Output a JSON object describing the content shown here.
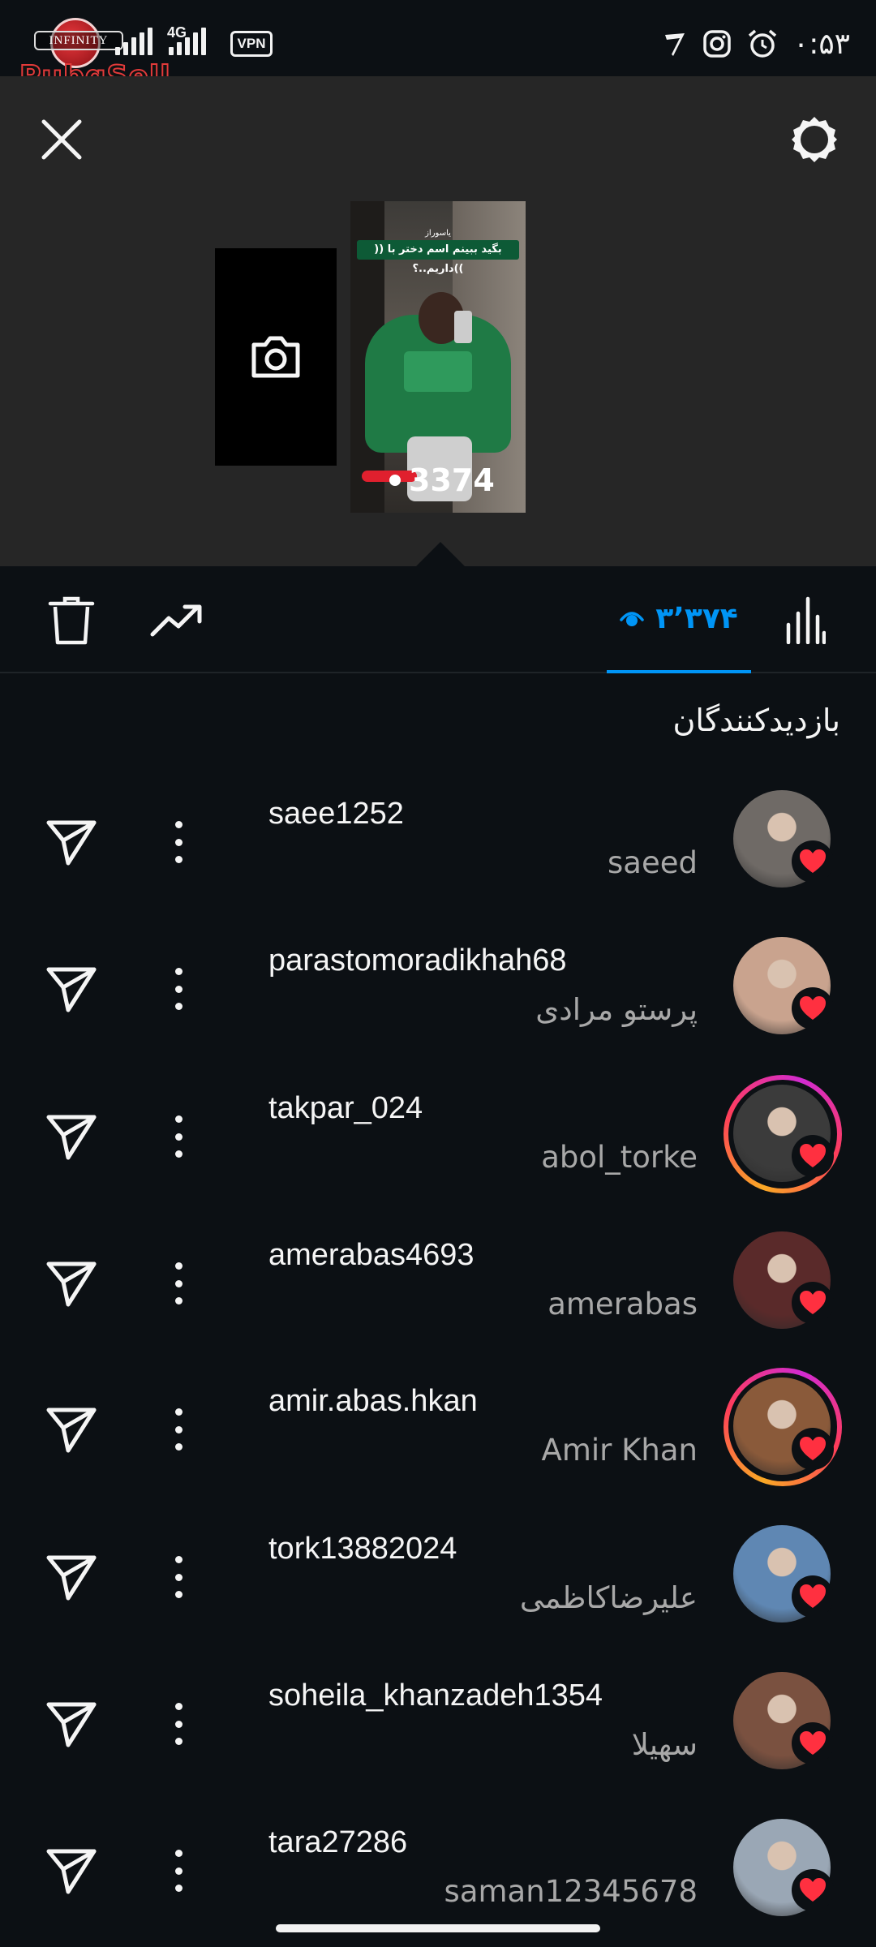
{
  "status_bar": {
    "network_type": "4G",
    "vpn_label": "VPN",
    "time": "۰:۵۳",
    "watermark_brand": "INFINITY",
    "watermark_text": "PubgSell"
  },
  "story": {
    "caption_top": "یاسوراز",
    "caption": "بگید ببینم اسم دختر با (( ))داریم..؟",
    "view_count_overlay": "3374"
  },
  "toolbar": {
    "viewers_count": "۳٬۳۷۴"
  },
  "viewers_section": {
    "title": "بازدیدکنندگان"
  },
  "viewers": [
    {
      "username": "saee1252",
      "full_name": "saeed",
      "has_story_ring": false,
      "avatar_color": "#6f6a66"
    },
    {
      "username": "parastomoradikhah68",
      "full_name": "پرستو مرادی",
      "has_story_ring": false,
      "avatar_color": "#c9a38e"
    },
    {
      "username": "takpar_024",
      "full_name": "abol_torke",
      "has_story_ring": true,
      "avatar_color": "#3b3b3b"
    },
    {
      "username": "amerabas4693",
      "full_name": "amerabas",
      "has_story_ring": false,
      "avatar_color": "#5a2a2a"
    },
    {
      "username": "amir.abas.hkan",
      "full_name": "Amir Khan",
      "has_story_ring": true,
      "avatar_color": "#8a5a3a"
    },
    {
      "username": "tork13882024",
      "full_name": "علیرضاکاظمی",
      "has_story_ring": false,
      "avatar_color": "#5f87b3"
    },
    {
      "username": "soheila_khanzadeh1354",
      "full_name": "سهیلا",
      "has_story_ring": false,
      "avatar_color": "#7a5140"
    },
    {
      "username": "tara27286",
      "full_name": "saman12345678",
      "has_story_ring": false,
      "avatar_color": "#9aa7b5"
    }
  ],
  "colors": {
    "background": "#0c1014",
    "accent": "#0095f6",
    "heart": "#ff3040",
    "secondary_text": "#a8a8a8"
  }
}
